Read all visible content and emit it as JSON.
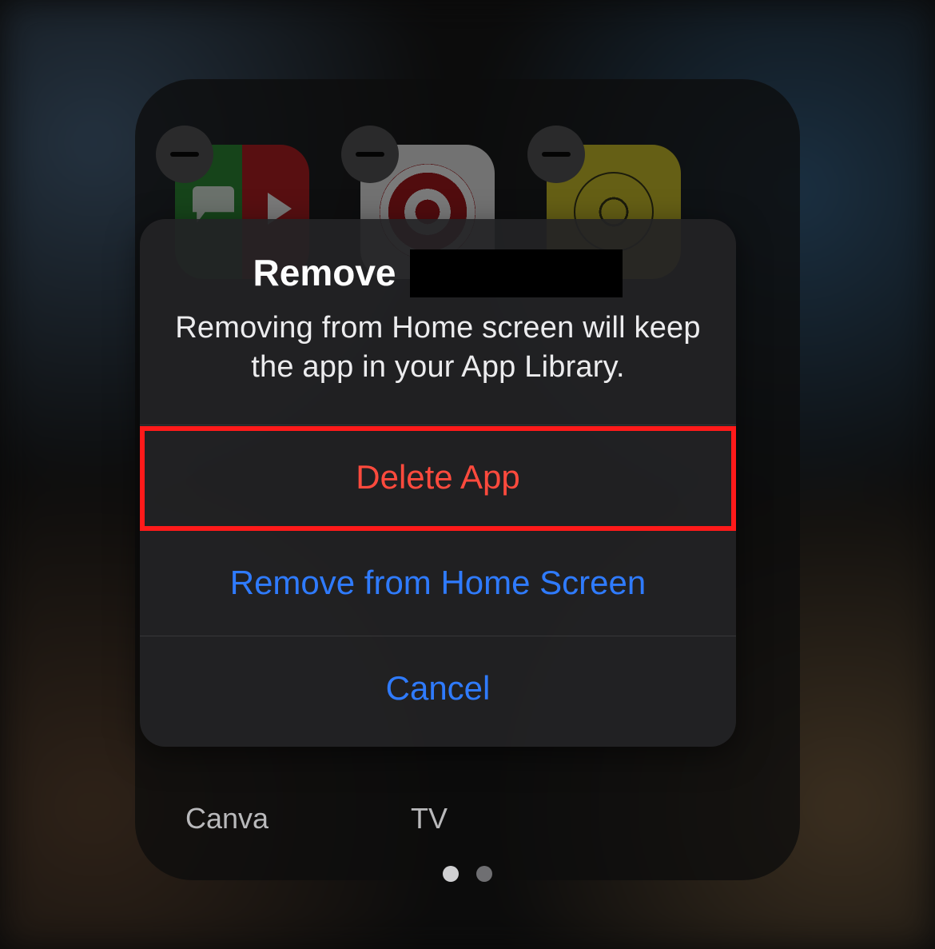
{
  "folder": {
    "apps": {
      "a1": {
        "name": "google-folder-app-icon"
      },
      "a2": {
        "name": "target-app-icon"
      },
      "a3": {
        "name": "astronomy-app-icon"
      }
    },
    "labels": {
      "l1": "Canva",
      "l2": "TV"
    }
  },
  "sheet": {
    "title_prefix": "Remove",
    "message": "Removing from Home screen will keep the app in your App Library.",
    "buttons": {
      "delete": "Delete App",
      "remove": "Remove from Home Screen",
      "cancel": "Cancel"
    }
  }
}
